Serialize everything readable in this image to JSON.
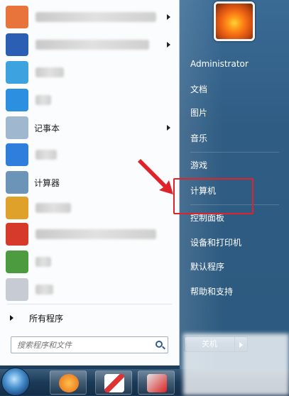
{
  "left_items": [
    {
      "label": "",
      "icon": "pdf-icon",
      "color": "#e8743b",
      "has_arrow": true,
      "blur_w": 170
    },
    {
      "label": "",
      "icon": "word-icon",
      "color": "#2b5fb4",
      "has_arrow": true,
      "blur_w": 160
    },
    {
      "label": "",
      "icon": "chat-icon",
      "color": "#3ca2e0",
      "has_arrow": false,
      "blur_w": 40
    },
    {
      "label": "",
      "icon": "plane-icon",
      "color": "#2d8fe0",
      "has_arrow": false,
      "blur_w": 22
    },
    {
      "label": "记事本",
      "icon": "notepad-icon",
      "color": "#9fb8cf",
      "has_arrow": true,
      "blur_w": 0
    },
    {
      "label": "",
      "icon": "wps-icon",
      "color": "#2f7ddc",
      "has_arrow": false,
      "blur_w": 30
    },
    {
      "label": "计算器",
      "icon": "calculator-icon",
      "color": "#6c93b8",
      "has_arrow": false,
      "blur_w": 0
    },
    {
      "label": "",
      "icon": "app-icon",
      "color": "#e0a12a",
      "has_arrow": false,
      "blur_w": 50
    },
    {
      "label": "",
      "icon": "stock-icon",
      "color": "#d63a2a",
      "has_arrow": false,
      "blur_w": 170
    },
    {
      "label": "",
      "icon": "magnifier-icon",
      "color": "#4c9b3f",
      "has_arrow": false,
      "blur_w": 22
    },
    {
      "label": "",
      "icon": "cards-icon",
      "color": "#c7ccd4",
      "has_arrow": false,
      "blur_w": 25
    }
  ],
  "all_programs": "所有程序",
  "search": {
    "placeholder": "搜索程序和文件"
  },
  "right_items": [
    "Administrator",
    "文档",
    "图片",
    "音乐",
    "游戏",
    "计算机",
    "控制面板",
    "设备和打印机",
    "默认程序",
    "帮助和支持"
  ],
  "shutdown_label": "关机",
  "colors": {
    "highlight": "#e0222a",
    "panel": "#2f5c83"
  }
}
